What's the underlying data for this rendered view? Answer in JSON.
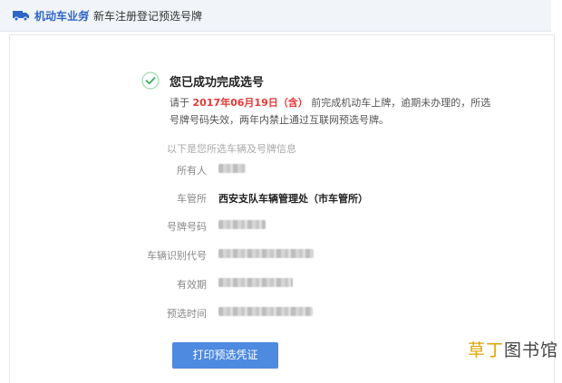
{
  "header": {
    "breadcrumb_root": "机动车业务",
    "separator": "/",
    "breadcrumb_current": "新车注册登记预选号牌",
    "accent_color": "#2f66c6"
  },
  "result": {
    "title": "您已成功完成选号",
    "notice_prefix": "请于",
    "notice_date": "2017年06月19日（含）",
    "notice_suffix": "前完成机动车上牌，逾期未办理的，所选号牌号码失效，两年内禁止通过互联网预选号牌。",
    "date_color": "#e23a3a"
  },
  "info": {
    "intro": "以下是您所选车辆及号牌信息",
    "rows": [
      {
        "label": "所有人",
        "value": ""
      },
      {
        "label": "车管所",
        "value": "西安支队车辆管理处（市车管所）"
      },
      {
        "label": "号牌号码",
        "value": ""
      },
      {
        "label": "车辆识别代号",
        "value": ""
      },
      {
        "label": "有效期",
        "value": ""
      },
      {
        "label": "预选时间",
        "value": ""
      }
    ]
  },
  "actions": {
    "print_label": "打印预选凭证",
    "button_color": "#4d8ae0"
  },
  "watermark": {
    "accent_part": "草丁",
    "rest_part": "图书馆"
  },
  "icons": {
    "header": "truck-icon",
    "success": "check-circle-icon"
  }
}
